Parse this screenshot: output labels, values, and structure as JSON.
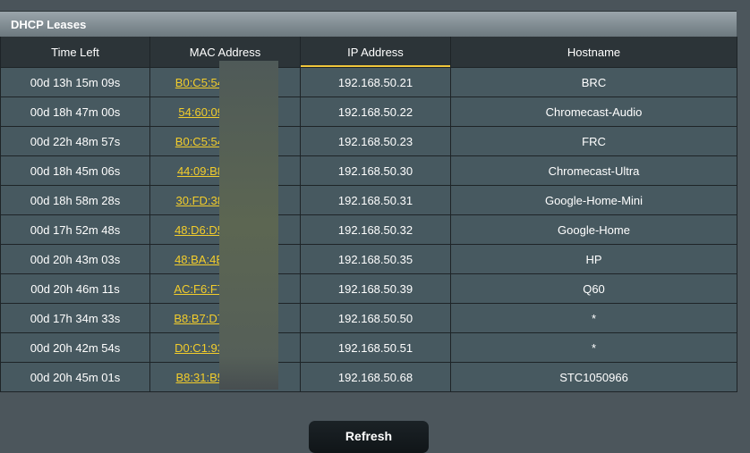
{
  "panel": {
    "title": "DHCP Leases"
  },
  "columns": [
    "Time Left",
    "MAC Address",
    "IP Address",
    "Hostname"
  ],
  "rows": [
    {
      "time": "00d 13h 15m 09s",
      "mac": "B0:C5:54",
      "ip": "192.168.50.21",
      "host": "BRC"
    },
    {
      "time": "00d 18h 47m 00s",
      "mac": "54:60:09",
      "ip": "192.168.50.22",
      "host": "Chromecast-Audio"
    },
    {
      "time": "00d 22h 48m 57s",
      "mac": "B0:C5:54",
      "ip": "192.168.50.23",
      "host": "FRC"
    },
    {
      "time": "00d 18h 45m 06s",
      "mac": "44:09:B8",
      "ip": "192.168.50.30",
      "host": "Chromecast-Ultra"
    },
    {
      "time": "00d 18h 58m 28s",
      "mac": "30:FD:38",
      "ip": "192.168.50.31",
      "host": "Google-Home-Mini"
    },
    {
      "time": "00d 17h 52m 48s",
      "mac": "48:D6:D5",
      "ip": "192.168.50.32",
      "host": "Google-Home"
    },
    {
      "time": "00d 20h 43m 03s",
      "mac": "48:BA:4E",
      "ip": "192.168.50.35",
      "host": "HP"
    },
    {
      "time": "00d 20h 46m 11s",
      "mac": "AC:F6:F7",
      "ip": "192.168.50.39",
      "host": "Q60"
    },
    {
      "time": "00d 17h 34m 33s",
      "mac": "B8:B7:D7",
      "ip": "192.168.50.50",
      "host": "*"
    },
    {
      "time": "00d 20h 42m 54s",
      "mac": "D0:C1:93",
      "ip": "192.168.50.51",
      "host": "*"
    },
    {
      "time": "00d 20h 45m 01s",
      "mac": "B8:31:B5",
      "ip": "192.168.50.68",
      "host": "STC1050966"
    }
  ],
  "sorted_column": "IP Address",
  "refresh_label": "Refresh"
}
